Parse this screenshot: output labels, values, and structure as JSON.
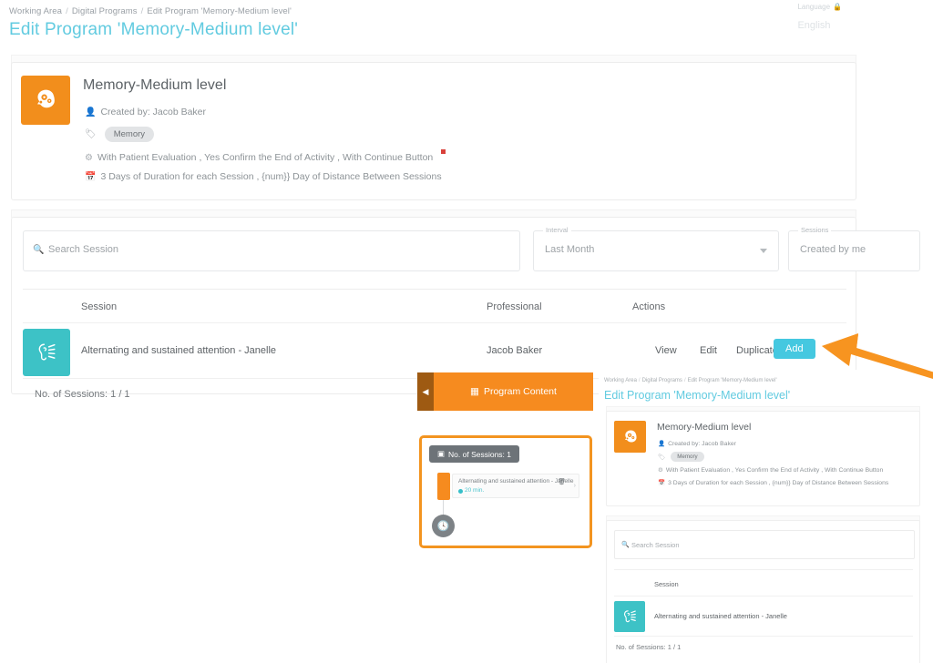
{
  "breadcrumb": {
    "items": [
      "Working Area",
      "Digital Programs",
      "Edit Program 'Memory-Medium level'"
    ],
    "separator": "/"
  },
  "page_title": "Edit Program 'Memory-Medium level'",
  "language": {
    "label": "Language",
    "lock_icon": "lock-icon",
    "value": "English"
  },
  "program": {
    "icon": "brain-gears-icon",
    "name": "Memory-Medium level",
    "created_by_label": "Created by:",
    "created_by": "Jacob Baker",
    "created_by_full": "Created by: Jacob Baker",
    "tag": "Memory",
    "options": "With Patient Evaluation , Yes Confirm the End of Activity , With Continue Button",
    "schedule": "3 Days of Duration for each Session , {num}} Day of Distance Between Sessions",
    "icons": {
      "user": "user-icon",
      "tag": "tag-icon",
      "options": "sliders-icon",
      "calendar": "calendar-icon"
    }
  },
  "filters": {
    "search": {
      "placeholder": "Search Session",
      "icon": "search-icon",
      "value": ""
    },
    "interval": {
      "legend": "Interval",
      "value": "Last Month",
      "icon": "chevron-down-icon"
    },
    "sessions": {
      "legend": "Sessions",
      "value": "Created by me"
    }
  },
  "table": {
    "headers": {
      "session": "Session",
      "professional": "Professional",
      "actions": "Actions"
    },
    "rows": [
      {
        "icon": "ear-sound-waves-icon",
        "session": "Alternating and sustained attention - Janelle",
        "professional": "Jacob Baker"
      }
    ],
    "actions": {
      "view": "View",
      "edit": "Edit",
      "duplicate": "Duplicate",
      "add": "Add"
    },
    "footer": "No. of Sessions: 1 / 1"
  },
  "program_content": {
    "handle_icon": "chevron-left-icon",
    "bar_icon": "grid-icon",
    "bar_label": "Program Content",
    "sessions_badge": {
      "icon": "calendar-icon",
      "label": "No. of Sessions: 1"
    },
    "activity_card": {
      "title": "Alternating and sustained attention - Janelle",
      "duration": "20 min.",
      "trash_icon": "trash-icon",
      "chevron_icon": "chevron-right-icon"
    },
    "add_time_button_icon": "clock-icon"
  },
  "mini_preview": {
    "breadcrumb": {
      "items": [
        "Working Area",
        "Digital Programs",
        "Edit Program 'Memory-Medium level'"
      ],
      "separator": "/"
    },
    "page_title": "Edit Program 'Memory-Medium level'",
    "program": {
      "icon": "brain-gears-icon",
      "name": "Memory-Medium level",
      "created_by_full": "Created by: Jacob Baker",
      "tag": "Memory",
      "options": "With Patient Evaluation , Yes Confirm the End of Activity , With Continue Button",
      "schedule": "3 Days of Duration for each Session , {num}} Day of Distance Between Sessions"
    },
    "search_placeholder": "Search Session",
    "table": {
      "header_session": "Session",
      "row_session": "Alternating and sustained attention - Janelle",
      "footer": "No. of Sessions: 1 / 1"
    }
  },
  "annotation": {
    "arrow": "left-pointing-arrow",
    "arrow_color": "#f79420",
    "target": "add-button"
  },
  "colors": {
    "accent_cyan": "#45c8e0",
    "teal": "#3dc2c6",
    "orange": "#f68b1f",
    "orange_dark": "#9e5a12",
    "annotation_orange": "#f79420",
    "title_blue": "#62cbe0",
    "red_marker": "#d9413b",
    "gray_badge": "#6d7378"
  }
}
